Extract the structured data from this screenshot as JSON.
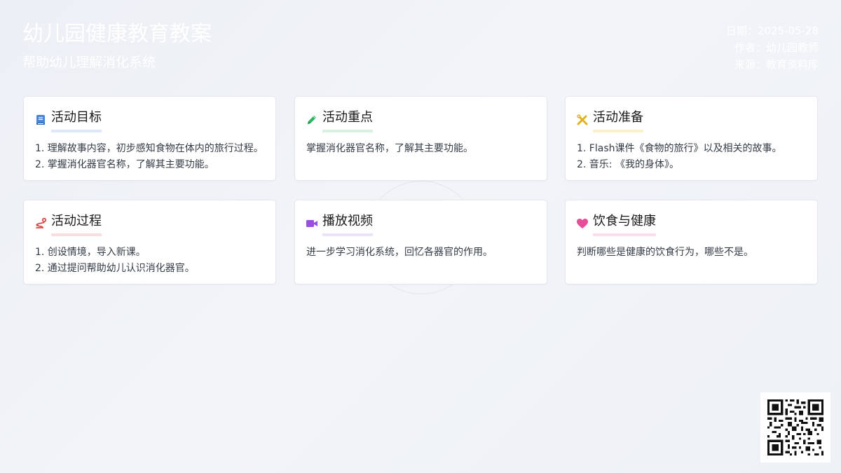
{
  "header": {
    "title": "幼儿园健康教育教案",
    "subtitle": "帮助幼儿理解消化系统",
    "date": "日期：2025-05-28",
    "author": "作者：幼儿园教师",
    "source": "来源：教育资料库"
  },
  "cards": [
    {
      "title": "活动目标",
      "icon": "book-icon",
      "accent": "#4a86d8",
      "underline": "#dde8f8",
      "lines": [
        "1. 理解故事内容，初步感知食物在体内的旅行过程。",
        "2. 掌握消化器官名称，了解其主要功能。"
      ]
    },
    {
      "title": "活动重点",
      "icon": "pencil-icon",
      "accent": "#2fb463",
      "underline": "#d9f3e2",
      "lines": [
        "掌握消化器官名称，了解其主要功能。"
      ]
    },
    {
      "title": "活动准备",
      "icon": "tools-icon",
      "accent": "#e0b21c",
      "underline": "#fbf0c8",
      "lines": [
        "1. Flash课件《食物的旅行》以及相关的故事。",
        "2. 音乐: 《我的身体》。"
      ]
    },
    {
      "title": "活动过程",
      "icon": "route-icon",
      "accent": "#d94b4b",
      "underline": "#f8dede",
      "lines": [
        "1. 创设情境，导入新课。",
        "2. 通过提问帮助幼儿认识消化器官。"
      ]
    },
    {
      "title": "播放视频",
      "icon": "video-camera-icon",
      "accent": "#9b4fe0",
      "underline": "#ece3f8",
      "lines": [
        "进一步学习消化系统，回忆各器官的作用。"
      ]
    },
    {
      "title": "饮食与健康",
      "icon": "heart-icon",
      "accent": "#e84d9a",
      "underline": "#fadeec",
      "lines": [
        "判断哪些是健康的饮食行为，哪些不是。"
      ]
    }
  ]
}
